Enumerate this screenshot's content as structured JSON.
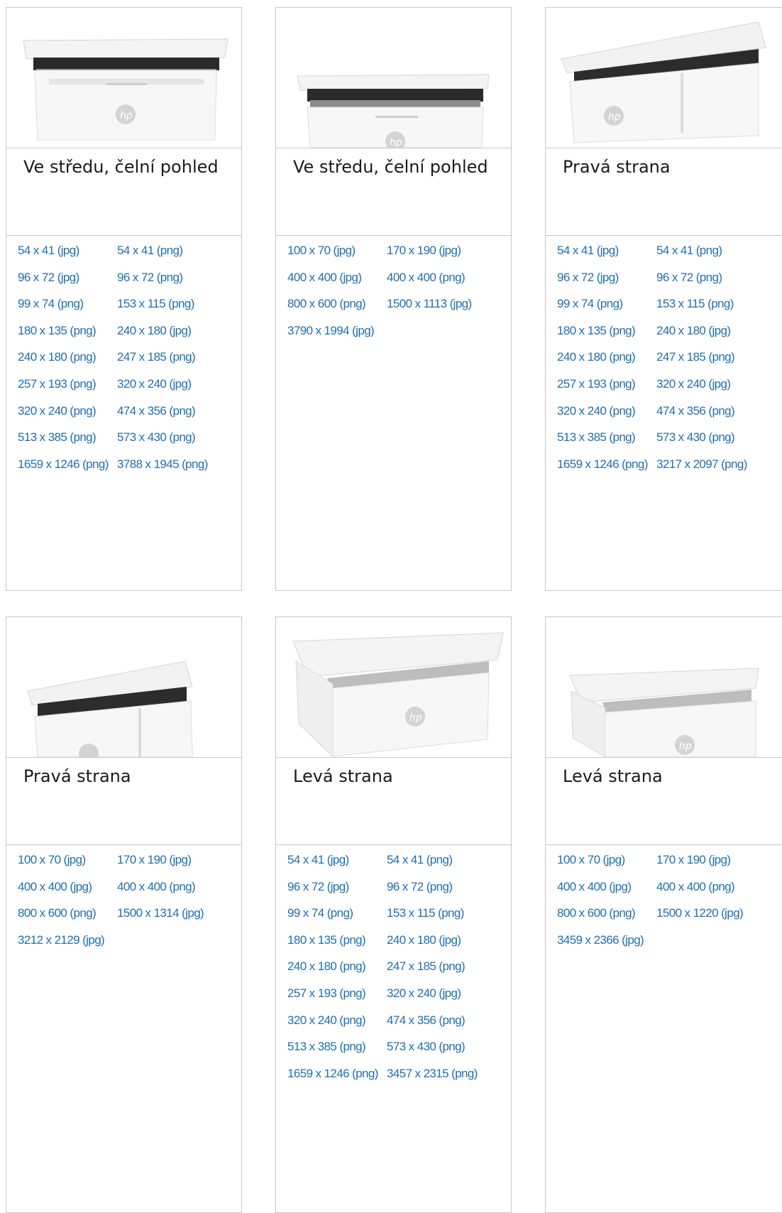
{
  "cards": [
    {
      "title": "Ve středu, čelní pohled",
      "links": [
        "54 x 41 (jpg)",
        "54 x 41 (png)",
        "96 x 72 (jpg)",
        "96 x 72 (png)",
        "99 x 74 (png)",
        "153 x 115 (png)",
        "180 x 135 (png)",
        "240 x 180 (jpg)",
        "240 x 180 (png)",
        "247 x 185 (png)",
        "257 x 193 (png)",
        "320 x 240 (jpg)",
        "320 x 240 (png)",
        "474 x 356 (png)",
        "513 x 385 (png)",
        "573 x 430 (png)",
        "1659 x 1246 (png)",
        "3788 x 1945 (png)"
      ]
    },
    {
      "title": "Ve středu, čelní pohled",
      "links": [
        "100 x 70 (jpg)",
        "170 x 190 (jpg)",
        "400 x 400 (jpg)",
        "400 x 400 (png)",
        "800 x 600 (png)",
        "1500 x 1113 (jpg)",
        "3790 x 1994 (jpg)"
      ]
    },
    {
      "title": "Pravá strana",
      "links": [
        "54 x 41 (jpg)",
        "54 x 41 (png)",
        "96 x 72 (jpg)",
        "96 x 72 (png)",
        "99 x 74 (png)",
        "153 x 115 (png)",
        "180 x 135 (png)",
        "240 x 180 (jpg)",
        "240 x 180 (png)",
        "247 x 185 (png)",
        "257 x 193 (png)",
        "320 x 240 (jpg)",
        "320 x 240 (png)",
        "474 x 356 (png)",
        "513 x 385 (png)",
        "573 x 430 (png)",
        "1659 x 1246 (png)",
        "3217 x 2097 (png)"
      ]
    },
    {
      "title": "Pravá strana",
      "links": [
        "100 x 70 (jpg)",
        "170 x 190 (jpg)",
        "400 x 400 (jpg)",
        "400 x 400 (png)",
        "800 x 600 (png)",
        "1500 x 1314 (jpg)",
        "3212 x 2129 (jpg)"
      ]
    },
    {
      "title": "Levá strana",
      "links": [
        "54 x 41 (jpg)",
        "54 x 41 (png)",
        "96 x 72 (jpg)",
        "96 x 72 (png)",
        "99 x 74 (png)",
        "153 x 115 (png)",
        "180 x 135 (png)",
        "240 x 180 (jpg)",
        "240 x 180 (png)",
        "247 x 185 (png)",
        "257 x 193 (png)",
        "320 x 240 (jpg)",
        "320 x 240 (png)",
        "474 x 356 (png)",
        "513 x 385 (png)",
        "573 x 430 (png)",
        "1659 x 1246 (png)",
        "3457 x 2315 (png)"
      ]
    },
    {
      "title": "Levá strana",
      "links": [
        "100 x 70 (jpg)",
        "170 x 190 (jpg)",
        "400 x 400 (jpg)",
        "400 x 400 (png)",
        "800 x 600 (png)",
        "1500 x 1220 (jpg)",
        "3459 x 2366 (jpg)"
      ]
    }
  ],
  "product_image": {
    "icon": "printer-image",
    "logo_text": "hp",
    "link_color": "#1f6fb2",
    "border_color": "#c8c8c8"
  }
}
